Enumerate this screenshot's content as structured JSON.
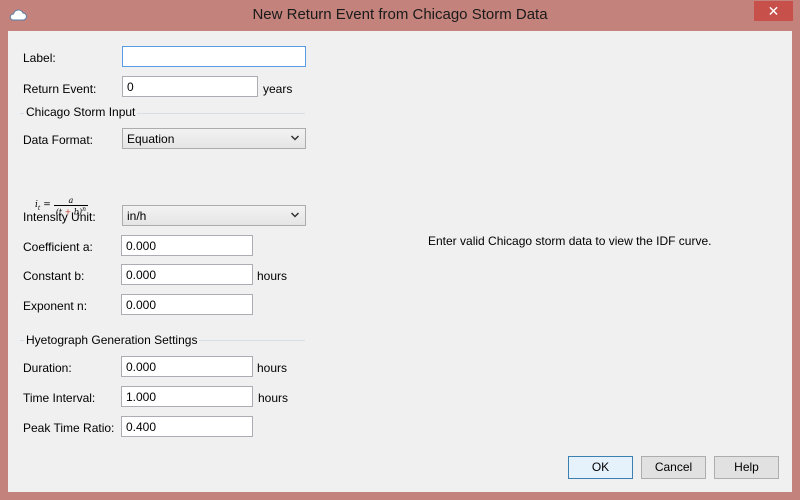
{
  "window": {
    "title": "New Return Event from Chicago Storm Data",
    "close_glyph": "✕",
    "icon": "cloud-icon"
  },
  "fields": {
    "label": {
      "label": "Label:",
      "value": ""
    },
    "return_event": {
      "label": "Return Event:",
      "value": "0",
      "unit": "years"
    }
  },
  "chicago_group": {
    "title": "Chicago Storm Input",
    "data_format": {
      "label": "Data Format:",
      "value": "Equation"
    },
    "formula": {
      "lhs": "i",
      "lhs_sub": "t",
      "eq": "=",
      "numerator": "a",
      "denominator_open": "(t",
      "plus": "+",
      "denominator_b": "b)",
      "exponent": "n"
    },
    "intensity_unit": {
      "label": "Intensity Unit:",
      "value": "in/h"
    },
    "coefficient_a": {
      "label": "Coefficient a:",
      "value": "0.000"
    },
    "constant_b": {
      "label": "Constant b:",
      "value": "0.000",
      "unit": "hours"
    },
    "exponent_n": {
      "label": "Exponent n:",
      "value": "0.000"
    }
  },
  "hyeto_group": {
    "title": "Hyetograph Generation Settings",
    "duration": {
      "label": "Duration:",
      "value": "0.000",
      "unit": "hours"
    },
    "time_interval": {
      "label": "Time Interval:",
      "value": "1.000",
      "unit": "hours"
    },
    "peak_ratio": {
      "label": "Peak Time Ratio:",
      "value": "0.400"
    }
  },
  "info_message": "Enter valid Chicago storm data to view the IDF curve.",
  "buttons": {
    "ok": "OK",
    "cancel": "Cancel",
    "help": "Help"
  },
  "colors": {
    "frame": "#c3837c",
    "close": "#c7504a",
    "client": "#f0f0f0",
    "focus_border": "#569de5",
    "formula_plus": "#c0392b"
  }
}
